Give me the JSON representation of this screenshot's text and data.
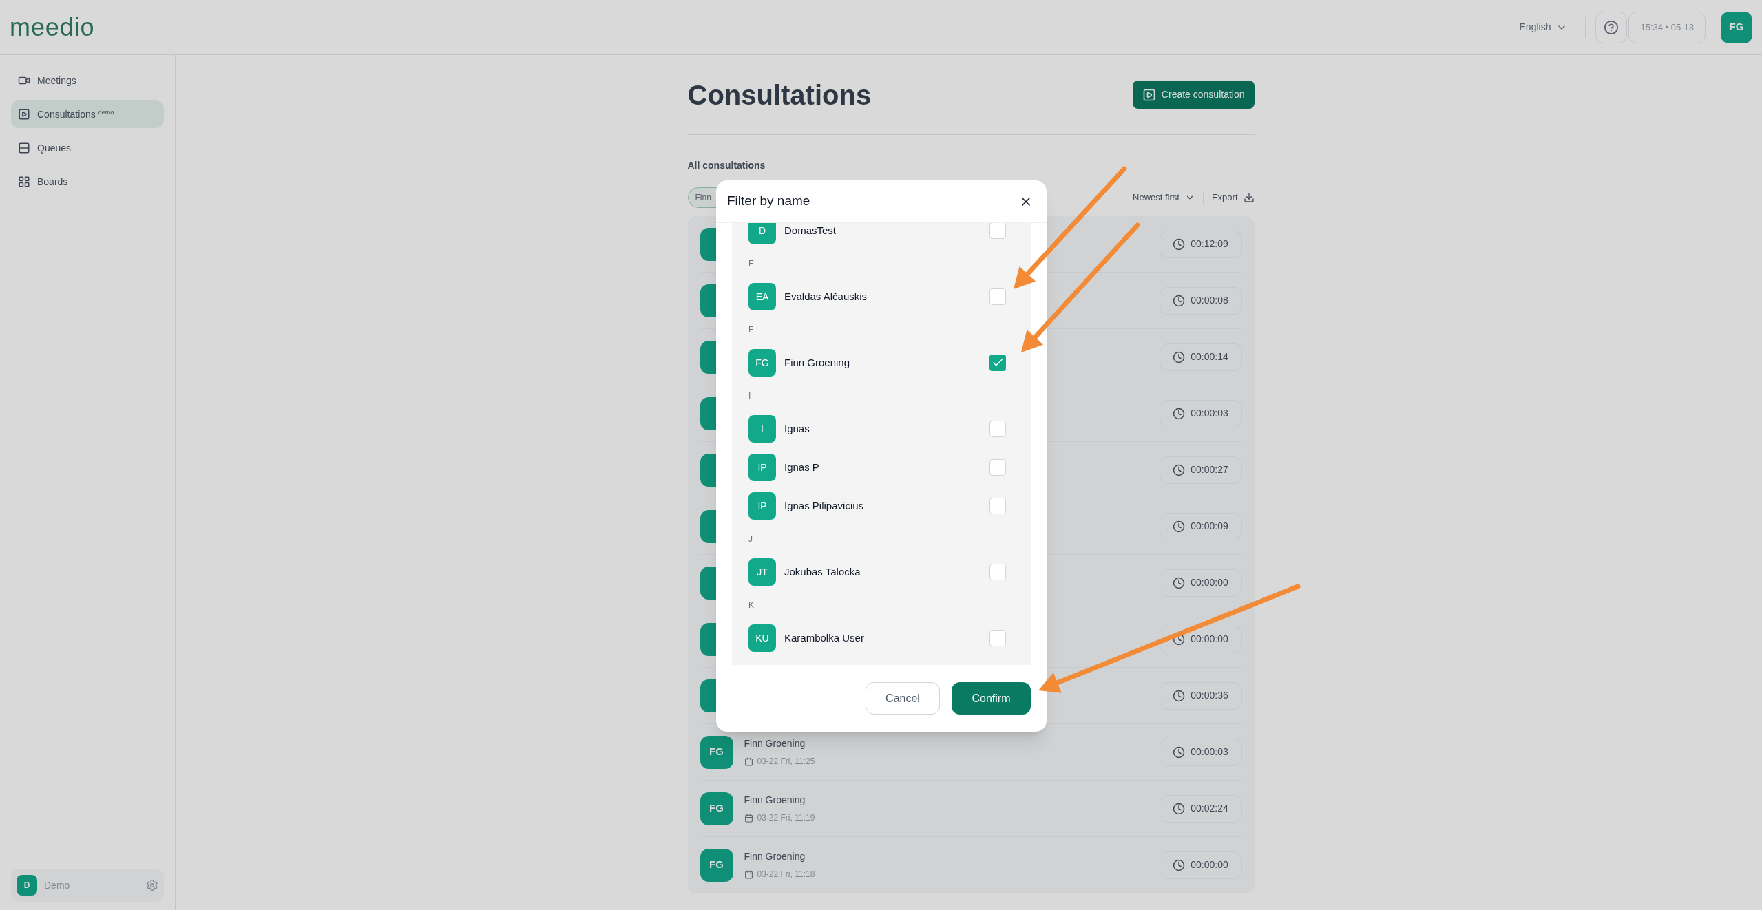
{
  "app": {
    "logo": "meedio",
    "language": "English",
    "clock": "15:34 • 05-13",
    "user_initials": "FG"
  },
  "sidebar": {
    "items": [
      {
        "label": "Meetings",
        "selected": false
      },
      {
        "label": "Consultations",
        "badge": "demo",
        "selected": true
      },
      {
        "label": "Queues",
        "selected": false
      },
      {
        "label": "Boards",
        "selected": false
      }
    ],
    "account": {
      "initials": "D",
      "name": "Demo"
    }
  },
  "page": {
    "title": "Consultations",
    "create_button": "Create consultation",
    "section_title": "All consultations",
    "filter_chip": "Finn",
    "sort": "Newest first",
    "export": "Export"
  },
  "consultations": [
    {
      "duration": "00:12:09"
    },
    {
      "duration": "00:00:08"
    },
    {
      "duration": "00:00:14"
    },
    {
      "duration": "00:00:03"
    },
    {
      "duration": "00:00:27"
    },
    {
      "duration": "00:00:09"
    },
    {
      "duration": "00:00:00"
    },
    {
      "duration": "00:00:00"
    },
    {
      "duration": "00:00:36"
    },
    {
      "initials": "FG",
      "name": "Finn Groening",
      "date": "03-22 Fri, 11:25",
      "duration": "00:00:03"
    },
    {
      "initials": "FG",
      "name": "Finn Groening",
      "date": "03-22 Fri, 11:19",
      "duration": "00:02:24"
    },
    {
      "initials": "FG",
      "name": "Finn Groening",
      "date": "03-22 Fri, 11:18",
      "duration": "00:00:00"
    }
  ],
  "modal": {
    "title": "Filter by name",
    "groups": [
      {
        "members": [
          {
            "initials": "D",
            "name": "DomasTest",
            "checked": false
          }
        ]
      },
      {
        "letter": "E",
        "members": [
          {
            "initials": "EA",
            "name": "Evaldas Alčauskis",
            "checked": false
          }
        ]
      },
      {
        "letter": "F",
        "members": [
          {
            "initials": "FG",
            "name": "Finn Groening",
            "checked": true
          }
        ]
      },
      {
        "letter": "I",
        "members": [
          {
            "initials": "I",
            "name": "Ignas",
            "checked": false
          },
          {
            "initials": "IP",
            "name": "Ignas P",
            "checked": false
          },
          {
            "initials": "IP",
            "name": "Ignas Pilipavicius",
            "checked": false
          }
        ]
      },
      {
        "letter": "J",
        "members": [
          {
            "initials": "JT",
            "name": "Jokubas Talocka",
            "checked": false
          }
        ]
      },
      {
        "letter": "K",
        "members": [
          {
            "initials": "KU",
            "name": "Karambolka User",
            "checked": false
          }
        ]
      }
    ],
    "cancel": "Cancel",
    "confirm": "Confirm"
  }
}
